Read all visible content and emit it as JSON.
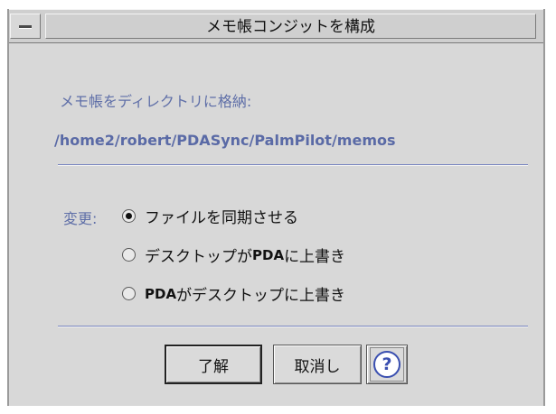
{
  "window": {
    "title": "メモ帳コンジットを構成"
  },
  "store": {
    "label": "メモ帳をディレクトリに格納:",
    "path": "/home2/robert/PDASync/PalmPilot/memos"
  },
  "change": {
    "label": "変更:",
    "options": [
      {
        "text": "ファイルを同期させる",
        "checked": true
      },
      {
        "pre": "デスクトップが ",
        "bold": "PDA",
        "post": " に上書き",
        "checked": false
      },
      {
        "pre": "",
        "bold": "PDA",
        "post": " がデスクトップに上書き",
        "checked": false
      }
    ]
  },
  "buttons": {
    "ok": "了解",
    "cancel": "取消し",
    "help": "?"
  }
}
